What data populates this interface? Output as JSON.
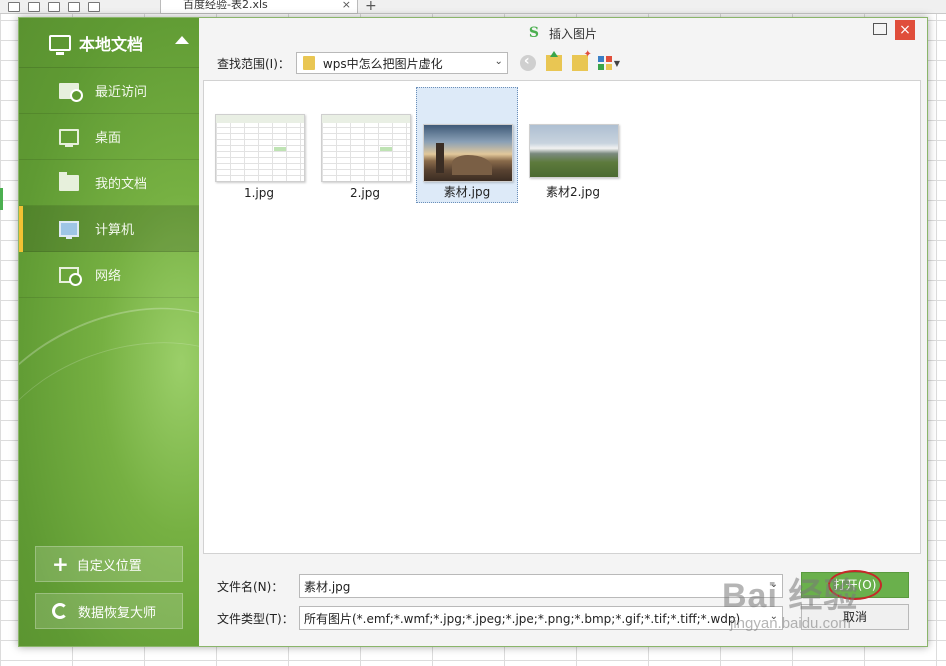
{
  "app": {
    "document_tab": "百度经验-表2.xls",
    "tab_close": "×",
    "new_tab": "+"
  },
  "dialog": {
    "title": "插入图片",
    "logo": "S",
    "close": "×"
  },
  "sidebar": {
    "header": "本地文档",
    "items": [
      {
        "label": "最近访问",
        "icon": "recent-icon"
      },
      {
        "label": "桌面",
        "icon": "desktop-icon"
      },
      {
        "label": "我的文档",
        "icon": "folder-icon"
      },
      {
        "label": "计算机",
        "icon": "computer-icon",
        "active": true
      },
      {
        "label": "网络",
        "icon": "network-icon"
      }
    ],
    "custom_location": "自定义位置",
    "recovery": "数据恢复大师"
  },
  "nav": {
    "look_in_label": "查找范围(I)：",
    "look_in_value": "wps中怎么把图片虚化"
  },
  "files": [
    {
      "name": "1.jpg",
      "kind": "spreadsheet-thumbnail"
    },
    {
      "name": "2.jpg",
      "kind": "spreadsheet-thumbnail"
    },
    {
      "name": "素材.jpg",
      "kind": "photo-thumbnail",
      "selected": true
    },
    {
      "name": "素材2.jpg",
      "kind": "photo-thumbnail"
    }
  ],
  "filename": {
    "label": "文件名(N)：",
    "value": "素材.jpg"
  },
  "filetype": {
    "label": "文件类型(T)：",
    "value": "所有图片(*.emf;*.wmf;*.jpg;*.jpeg;*.jpe;*.png;*.bmp;*.gif;*.tif;*.tiff;*.wdp)"
  },
  "buttons": {
    "open": "打开(O)",
    "cancel": "取消"
  },
  "watermark": {
    "main": "Bai 经验",
    "sub": "jingyan.baidu.com"
  },
  "colors": {
    "sidebar_green": "#6aa83a",
    "accent_yellow": "#f2c233",
    "close_red": "#e04e3b",
    "open_green": "#6ab04c",
    "annotation_red": "#c62828"
  }
}
